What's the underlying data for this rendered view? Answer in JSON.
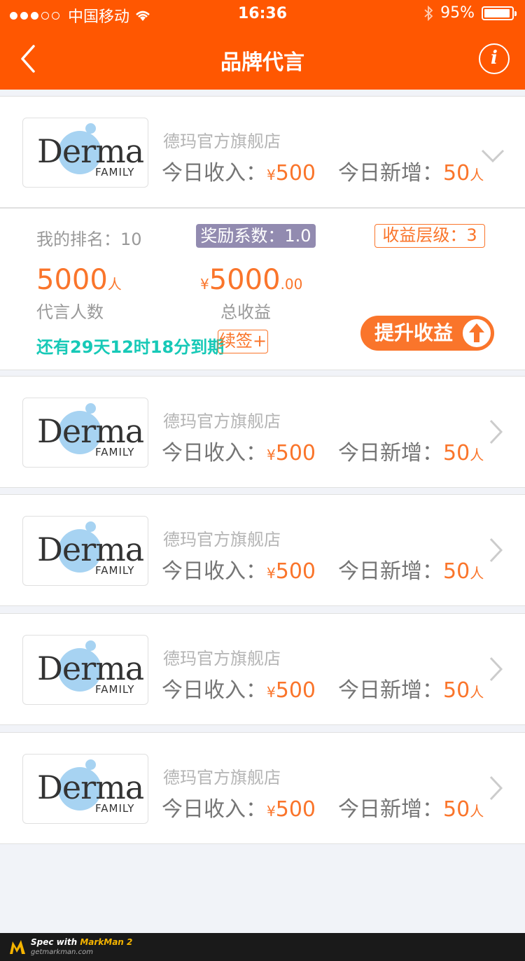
{
  "status_bar": {
    "carrier": "中国移动",
    "time": "16:36",
    "battery": "95%"
  },
  "nav": {
    "title": "品牌代言",
    "back_icon": "chevron-left-icon",
    "info_icon": "info-icon"
  },
  "brand_logo": {
    "word": "Derma",
    "sub": "FAMILY"
  },
  "brand_cards": [
    {
      "shop_name": "德玛官方旗舰店",
      "income_label": "今日收入：",
      "currency": "¥",
      "income_value": "500",
      "new_label": "今日新增：",
      "new_value": "50",
      "new_unit": "人",
      "expanded": true
    },
    {
      "shop_name": "德玛官方旗舰店",
      "income_label": "今日收入：",
      "currency": "¥",
      "income_value": "500",
      "new_label": "今日新增：",
      "new_value": "50",
      "new_unit": "人",
      "expanded": false
    },
    {
      "shop_name": "德玛官方旗舰店",
      "income_label": "今日收入：",
      "currency": "¥",
      "income_value": "500",
      "new_label": "今日新增：",
      "new_value": "50",
      "new_unit": "人",
      "expanded": false
    },
    {
      "shop_name": "德玛官方旗舰店",
      "income_label": "今日收入：",
      "currency": "¥",
      "income_value": "500",
      "new_label": "今日新增：",
      "new_value": "50",
      "new_unit": "人",
      "expanded": false
    },
    {
      "shop_name": "德玛官方旗舰店",
      "income_label": "今日收入：",
      "currency": "¥",
      "income_value": "500",
      "new_label": "今日新增：",
      "new_value": "50",
      "new_unit": "人",
      "expanded": false
    }
  ],
  "detail": {
    "rank_label": "我的排名：",
    "rank_value": "10",
    "reward_label": "奖励系数：",
    "reward_value": "1.0",
    "level_label": "收益层级：",
    "level_value": "3",
    "endorsers_value": "5000",
    "endorsers_unit": "人",
    "endorsers_label": "代言人数",
    "total_currency": "¥",
    "total_value": "5000",
    "total_decimal": ".00",
    "total_label": "总收益",
    "expire_text": "还有29天12时18分到期",
    "renew_label": "续签",
    "renew_plus": "+",
    "upgrade_label": "提升收益"
  },
  "colors": {
    "primary": "#ff5701",
    "background": "#f1f3f8",
    "divider": "#e0e0e0",
    "shop_name": "#b5b5b5",
    "stat_label": "#757575",
    "accent": "#fa752b",
    "gray_text": "#999999",
    "reward_badge": "#928bb0",
    "expire": "#17c9b7",
    "chevron": "#cccccc"
  },
  "footer": {
    "spec_text": "Spec with ",
    "spec_app": "MarkMan 2",
    "site": "getmarkman.com"
  }
}
